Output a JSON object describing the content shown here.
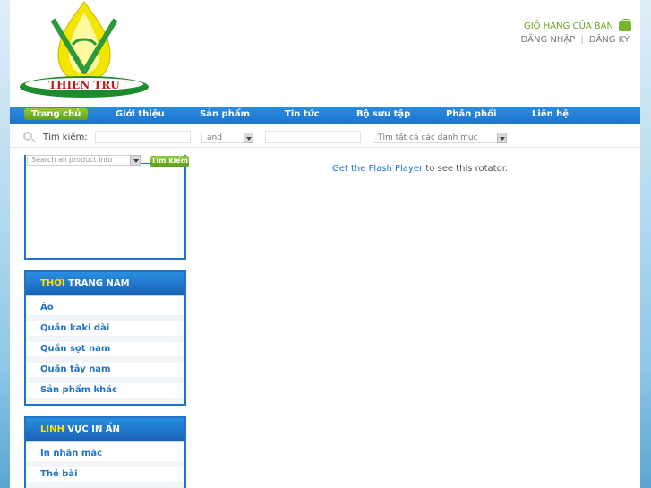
{
  "header": {
    "logo_text": "THIEN TRU",
    "cart_label": "GIỎ HÀNG CỦA BẠN",
    "login_label": "ĐĂNG NHẬP",
    "register_label": "ĐĂNG KÝ"
  },
  "nav": {
    "items": [
      {
        "label": "Trang chủ",
        "active": true
      },
      {
        "label": "Giới thiệu"
      },
      {
        "label": "Sản phẩm"
      },
      {
        "label": "Tin tức"
      },
      {
        "label": "Bộ sưu tập"
      },
      {
        "label": "Phân phối"
      },
      {
        "label": "Liên hệ"
      }
    ]
  },
  "search": {
    "label": "Tìm kiếm:",
    "operator_value": "and",
    "category_value": "Tìm tất cả các danh mục"
  },
  "product_search": {
    "placeholder": "Search all product info",
    "button_label": "Tìm kiếm"
  },
  "flash_notice": {
    "link_text": "Get the Flash Player",
    "rest_text": " to see this rotator."
  },
  "categories": [
    {
      "title_highlight": "THỜI",
      "title_rest": " TRANG NAM",
      "items": [
        "Áo",
        "Quần kaki dài",
        "Quần sọt nam",
        "Quần tây nam",
        "Sản phẩm khác"
      ]
    },
    {
      "title_highlight": "LĨNH",
      "title_rest": " VỰC IN ẤN",
      "items": [
        "In nhãn mác",
        "Thẻ bài"
      ]
    }
  ],
  "colors": {
    "accent_blue": "#1f73c9",
    "accent_green": "#6aa31e",
    "heading_highlight": "#ffe000"
  }
}
